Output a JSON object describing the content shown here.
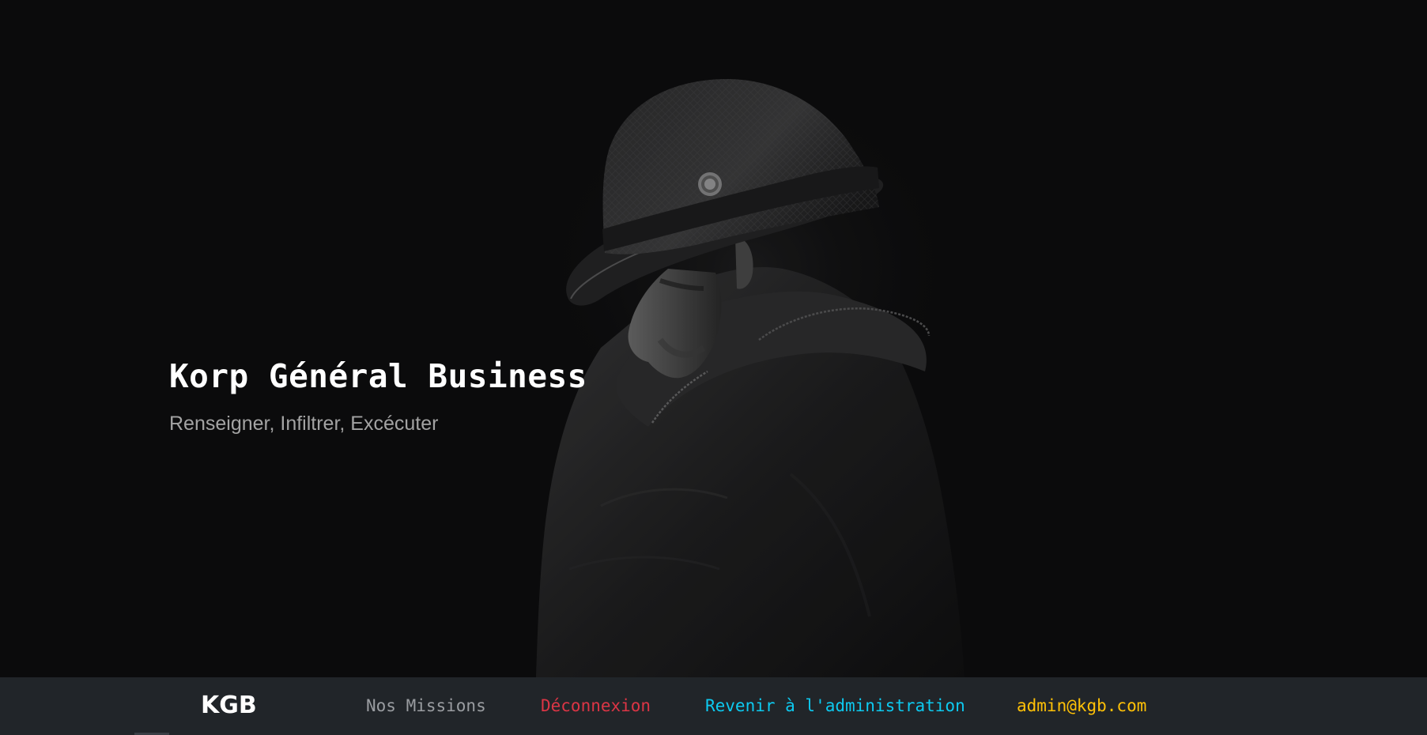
{
  "hero": {
    "title": "Korp Général Business",
    "subtitle": "Renseigner, Infiltrer, Excécuter",
    "image_subject": "man-in-fedora-and-coat-silhouette"
  },
  "navbar": {
    "brand": "KGB",
    "links": {
      "missions": "Nos Missions",
      "logout": "Déconnexion",
      "admin": "Revenir à l'administration",
      "user_email": "admin@kgb.com"
    }
  },
  "colors": {
    "background": "#0d0d0e",
    "navbar": "#212529",
    "missions": "#9a9da1",
    "logout": "#dc3545",
    "admin": "#0dcaf0",
    "user_email": "#ffc107"
  }
}
